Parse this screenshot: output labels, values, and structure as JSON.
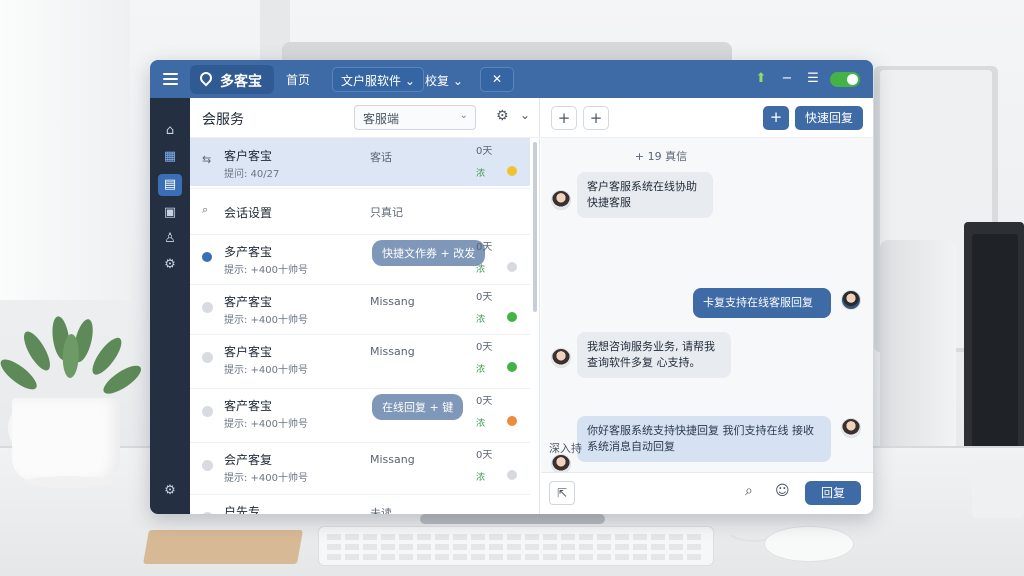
{
  "app": {
    "brand": "多客宝",
    "nav": {
      "home": "首页",
      "tools": "文户服软件 ⌄",
      "account": "校复 ⌄",
      "close": "✕"
    }
  },
  "sidebar": {
    "icons": [
      "home-icon",
      "grid-icon",
      "clipboard-icon",
      "monitor-icon",
      "user-icon",
      "settings-icon",
      "bottom-settings-icon"
    ]
  },
  "list": {
    "title": "会服务",
    "filter_value": "客服端",
    "conversations": [
      {
        "name": "客户客宝",
        "sub": "提问: 40/27",
        "preview": "客话",
        "time": "0天",
        "tag": "浓",
        "status": "#f1c232",
        "type": "arrow",
        "selected": true
      },
      {
        "name": "会话设置",
        "sub": "",
        "preview": "只真记",
        "time": "",
        "tag": "",
        "status": "",
        "type": "search",
        "selected": false
      },
      {
        "name": "多产客宝",
        "sub": "提示: +400十帅号",
        "bubble": "快捷文作券 + 改发",
        "time": "0天",
        "tag": "浓",
        "status": "#d6d9de",
        "type": "unread",
        "selected": false
      },
      {
        "name": "客产客宝",
        "sub": "提示: +400十帅号",
        "preview": "Missang",
        "time": "0天",
        "tag": "浓",
        "status": "#43b348",
        "type": "read",
        "selected": false
      },
      {
        "name": "客户客宝",
        "sub": "提示: +400十帅号",
        "preview": "Missang",
        "time": "0天",
        "tag": "浓",
        "status": "#43b348",
        "type": "read",
        "selected": false
      },
      {
        "name": "客产客宝",
        "sub": "提示: +400十帅号",
        "bubble": "在线回复 + 键",
        "time": "0天",
        "tag": "浓",
        "status": "#ed8a3b",
        "type": "read",
        "selected": false
      },
      {
        "name": "会产客复",
        "sub": "提示: +400十帅号",
        "preview": "Missang",
        "time": "0天",
        "tag": "浓",
        "status": "#d6d9de",
        "type": "read",
        "selected": false
      },
      {
        "name": "户先专",
        "sub": "",
        "preview": "未读",
        "time": "",
        "tag": "",
        "status": "",
        "type": "read",
        "selected": false
      }
    ]
  },
  "chat": {
    "toolbar": {
      "quick_reply": "快速回复"
    },
    "meta": "+ 19 真信",
    "messages": [
      {
        "dir": "in",
        "text": "客户客服系统在线协助快捷客服"
      },
      {
        "dir": "out",
        "text": "卡复支持在线客服回复"
      },
      {
        "dir": "in",
        "text": "我想咨询服务业务, 请帮我查询软件多复 心支持。"
      },
      {
        "dir": "pale",
        "text": "你好客服系统支持快捷回复 我们支持在线 接收系统消息自动回复"
      }
    ],
    "input_label": "深入持",
    "send": "回复"
  },
  "colors": {
    "topbar": "#3e6aa6",
    "sidebar": "#243042",
    "accent": "#3e6aa6",
    "selected_row": "#dce6f4"
  }
}
